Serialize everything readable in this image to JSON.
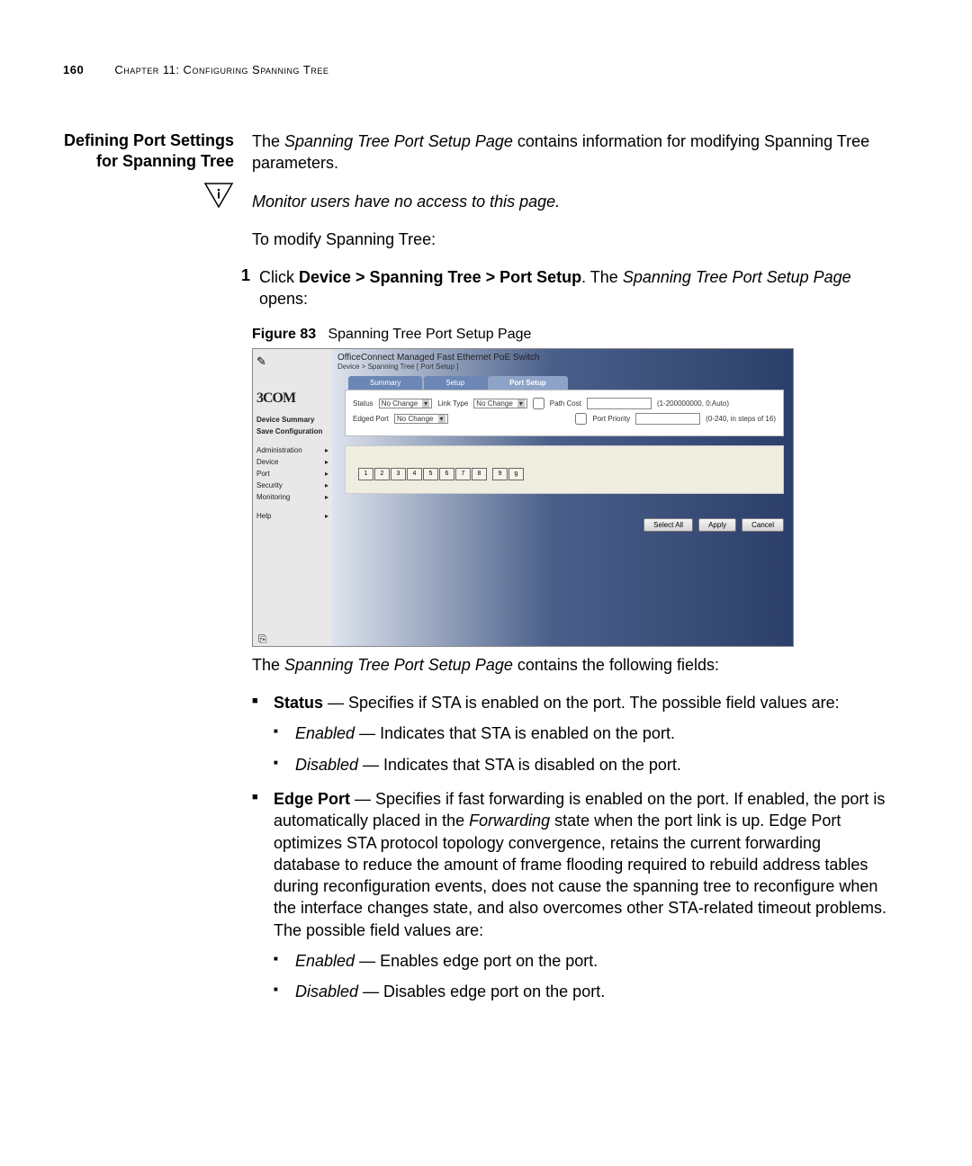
{
  "header": {
    "page_number": "160",
    "chapter": "Chapter 11: Configuring Spanning Tree"
  },
  "sidebar_heading": "Defining Port Settings for Spanning Tree",
  "intro": {
    "p1_pre": "The ",
    "p1_em": "Spanning Tree Port Setup Page",
    "p1_post": " contains information for modifying Spanning Tree parameters.",
    "note": "Monitor users have no access to this page.",
    "p2": "To modify Spanning Tree:"
  },
  "step": {
    "num": "1",
    "pre": "Click ",
    "bold": "Device > Spanning Tree > Port Setup",
    "mid": ". The ",
    "em": "Spanning Tree Port Setup Page",
    "post": " opens:"
  },
  "figure": {
    "label": "Figure 83",
    "caption": "Spanning Tree Port Setup Page"
  },
  "screenshot": {
    "brand": "3COM",
    "title": "OfficeConnect Managed Fast Ethernet PoE Switch",
    "breadcrumb": "Device > Spanning Tree [ Port Setup ]",
    "nav": [
      {
        "label": "Device Summary",
        "bold": true,
        "arrow": false
      },
      {
        "label": "Save Configuration",
        "bold": true,
        "arrow": false
      },
      {
        "label": "Administration",
        "bold": false,
        "arrow": true
      },
      {
        "label": "Device",
        "bold": false,
        "arrow": true
      },
      {
        "label": "Port",
        "bold": false,
        "arrow": true
      },
      {
        "label": "Security",
        "bold": false,
        "arrow": true
      },
      {
        "label": "Monitoring",
        "bold": false,
        "arrow": true
      },
      {
        "label": "Help",
        "bold": false,
        "arrow": true
      }
    ],
    "tabs": [
      "Summary",
      "Setup",
      "Port Setup"
    ],
    "active_tab": 2,
    "form": {
      "status_label": "Status",
      "status_value": "No Change",
      "linktype_label": "Link Type",
      "linktype_value": "No Change",
      "pathcost_label": "Path Cost",
      "pathcost_hint": "(1-200000000, 0:Auto)",
      "edgedport_label": "Edged Port",
      "edgedport_value": "No Change",
      "portpriority_label": "Port Priority",
      "portpriority_hint": "(0-240, in steps of 16)"
    },
    "ports": [
      "1",
      "2",
      "3",
      "4",
      "5",
      "6",
      "7",
      "8",
      "9",
      "g"
    ],
    "buttons": {
      "select_all": "Select All",
      "apply": "Apply",
      "cancel": "Cancel"
    }
  },
  "after_fig": {
    "pre": "The ",
    "em": "Spanning Tree Port Setup Page",
    "post": " contains the following fields:"
  },
  "fields": {
    "status": {
      "name": "Status",
      "desc": " — Specifies if STA is enabled on the port. The possible field values are:",
      "opts": [
        {
          "name": "Enabled",
          "desc": " — Indicates that STA is enabled on the port."
        },
        {
          "name": "Disabled",
          "desc": " — Indicates that STA is disabled on the port."
        }
      ]
    },
    "edgeport": {
      "name": "Edge Port",
      "desc_pre": " — Specifies if fast forwarding is enabled on the port. If enabled, the port is automatically placed in the ",
      "desc_em": "Forwarding",
      "desc_post": " state when the port link is up. Edge Port optimizes STA protocol topology convergence, retains the current forwarding database to reduce the amount of frame flooding required to rebuild address tables during reconfiguration events, does not cause the spanning tree to reconfigure when the interface changes state, and also overcomes other STA-related timeout problems. The possible field values are:",
      "opts": [
        {
          "name": "Enabled",
          "desc": " — Enables edge port on the port."
        },
        {
          "name": "Disabled",
          "desc": " — Disables edge port on the port."
        }
      ]
    }
  }
}
